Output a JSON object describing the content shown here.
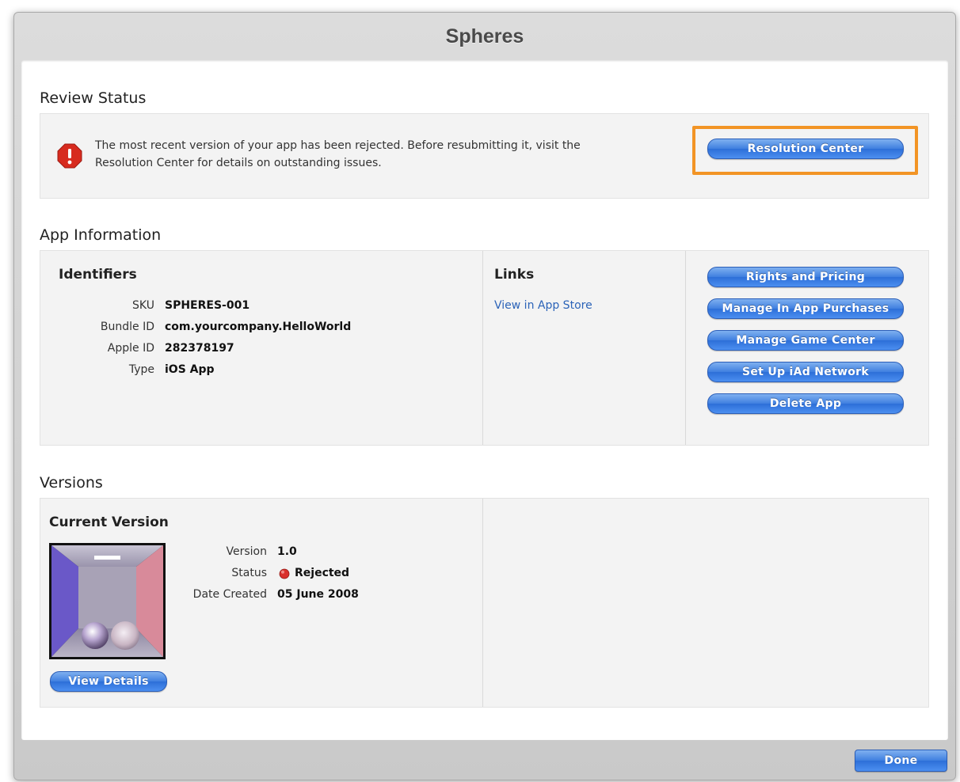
{
  "window": {
    "title": "Spheres"
  },
  "review_status": {
    "heading": "Review Status",
    "message_line1": "The most recent version of your app has been rejected. Before resubmitting it, visit the",
    "message_line2": "Resolution Center for details on outstanding issues.",
    "resolution_button": "Resolution Center",
    "alert_icon": "exclamation-octagon-icon"
  },
  "app_information": {
    "heading": "App Information",
    "identifiers": {
      "heading": "Identifiers",
      "rows": [
        {
          "label": "SKU",
          "value": "SPHERES-001"
        },
        {
          "label": "Bundle ID",
          "value": "com.yourcompany.HelloWorld"
        },
        {
          "label": "Apple ID",
          "value": "282378197"
        },
        {
          "label": "Type",
          "value": "iOS App"
        }
      ]
    },
    "links": {
      "heading": "Links",
      "items": [
        "View in App Store"
      ]
    },
    "actions": [
      "Rights and Pricing",
      "Manage In App Purchases",
      "Manage Game Center",
      "Set Up iAd Network",
      "Delete App"
    ]
  },
  "versions": {
    "heading": "Versions",
    "current": {
      "heading": "Current Version",
      "rows": [
        {
          "label": "Version",
          "value": "1.0"
        },
        {
          "label": "Status",
          "value": "Rejected"
        },
        {
          "label": "Date Created",
          "value": "05 June 2008"
        }
      ],
      "view_details_button": "View Details",
      "status_color": "#d9302c"
    }
  },
  "footer": {
    "done_button": "Done"
  },
  "colors": {
    "accent": "#3f7fe0",
    "highlight": "#f29425",
    "link": "#2b63b8"
  }
}
